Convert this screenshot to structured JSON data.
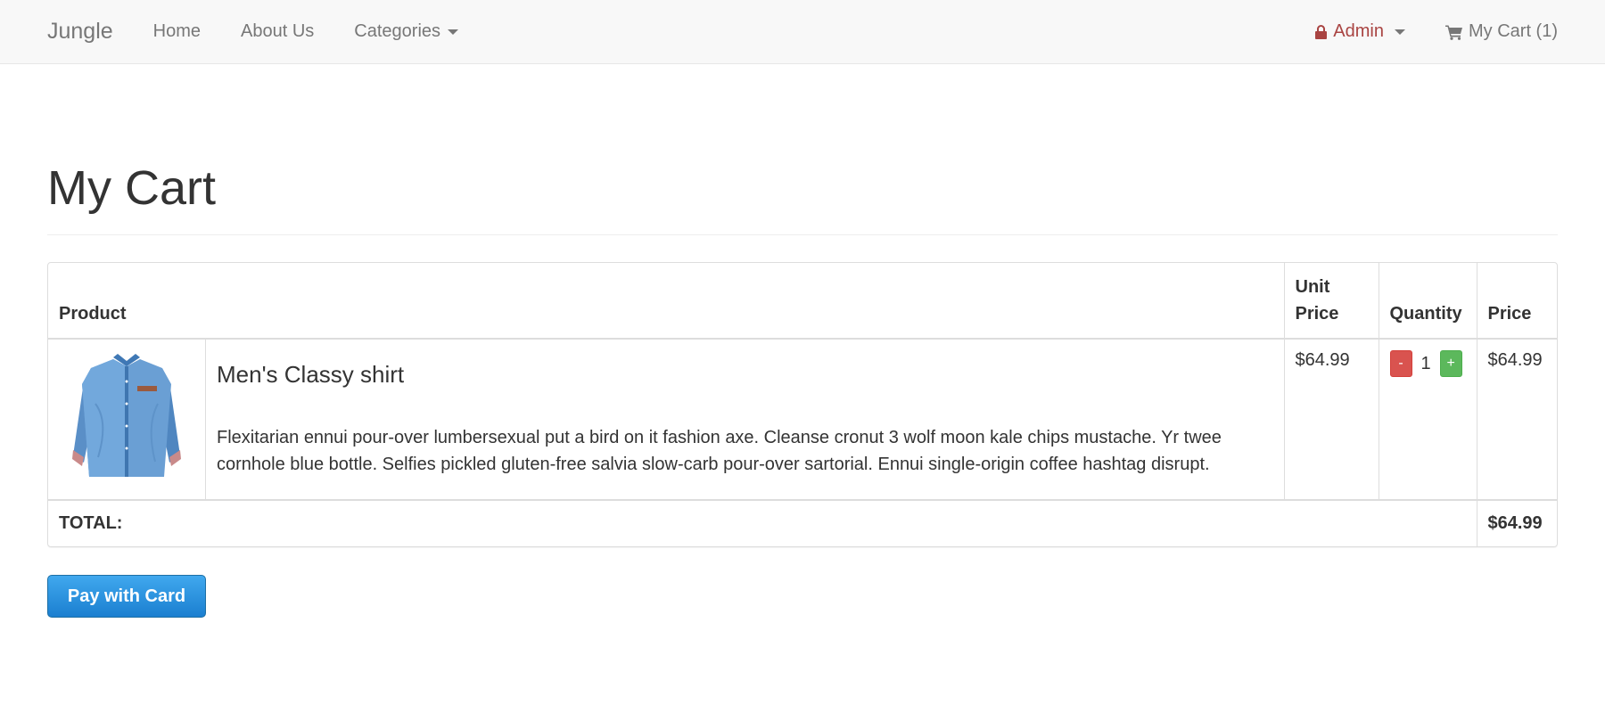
{
  "navbar": {
    "brand": "Jungle",
    "links": [
      "Home",
      "About Us",
      "Categories"
    ],
    "admin_label": "Admin",
    "cart_label": "My Cart (1)",
    "colors": {
      "admin": "#a94442",
      "link": "#777777",
      "background": "#f8f8f8"
    },
    "icons": {
      "admin": "lock-icon",
      "cart": "cart-icon"
    }
  },
  "page": {
    "title": "My Cart"
  },
  "table": {
    "headers": {
      "product": "Product",
      "unit_price": "Unit Price",
      "quantity": "Quantity",
      "price": "Price"
    },
    "rows": [
      {
        "image": "shirt-image",
        "title": "Men's Classy shirt",
        "description": "Flexitarian ennui pour-over lumbersexual put a bird on it fashion axe. Cleanse cronut 3 wolf moon kale chips mustache. Yr twee cornhole blue bottle. Selfies pickled gluten-free salvia slow-carb pour-over sartorial. Ennui single-origin coffee hashtag disrupt.",
        "unit_price": "$64.99",
        "quantity": "1",
        "minus_label": "-",
        "plus_label": "+",
        "price": "$64.99"
      }
    ],
    "footer": {
      "label": "TOTAL:",
      "total": "$64.99"
    }
  },
  "actions": {
    "pay_label": "Pay with Card",
    "pay_color": "#1b7fd0"
  }
}
